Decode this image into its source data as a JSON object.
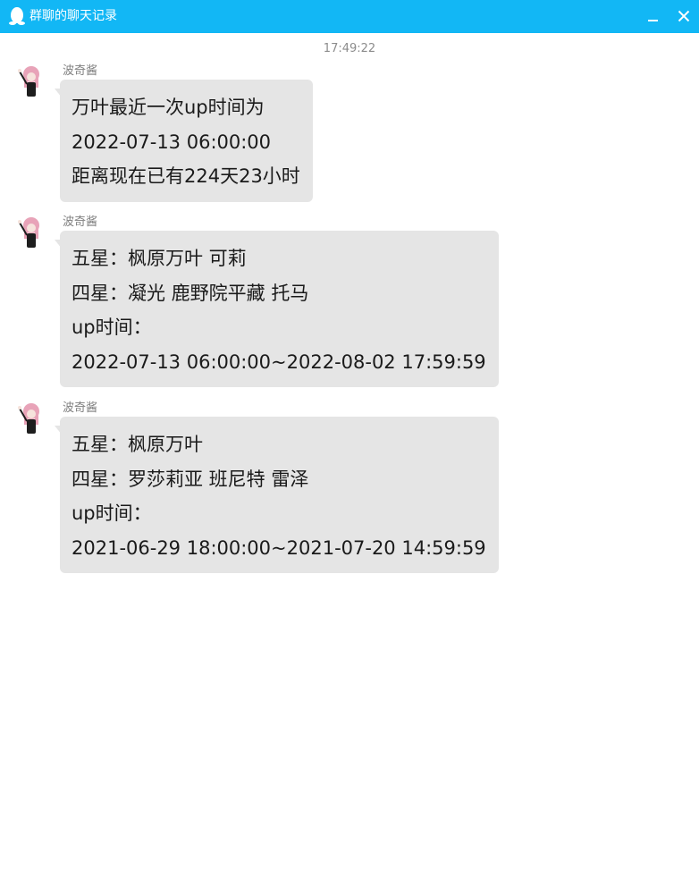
{
  "window": {
    "title": "群聊的聊天记录"
  },
  "timestamp": "17:49:22",
  "messages": [
    {
      "sender": "波奇酱",
      "lines": [
        "万叶最近一次up时间为",
        "2022-07-13 06:00:00",
        "距离现在已有224天23小时"
      ]
    },
    {
      "sender": "波奇酱",
      "lines": [
        "五星：枫原万叶 可莉",
        "四星：凝光 鹿野院平藏 托马",
        "up时间：",
        "2022-07-13 06:00:00~2022-08-02 17:59:59"
      ]
    },
    {
      "sender": "波奇酱",
      "lines": [
        "五星：枫原万叶",
        "四星：罗莎莉亚 班尼特 雷泽",
        "up时间：",
        "2021-06-29 18:00:00~2021-07-20 14:59:59"
      ]
    }
  ],
  "icons": {
    "app": "qq-penguin-icon",
    "minimize": "minimize-icon",
    "close": "close-icon",
    "avatar": "anime-girl-avatar"
  },
  "colors": {
    "titlebar": "#12b7f5",
    "bubble": "#e5e5e5",
    "timestamp": "#8c8c8c"
  }
}
